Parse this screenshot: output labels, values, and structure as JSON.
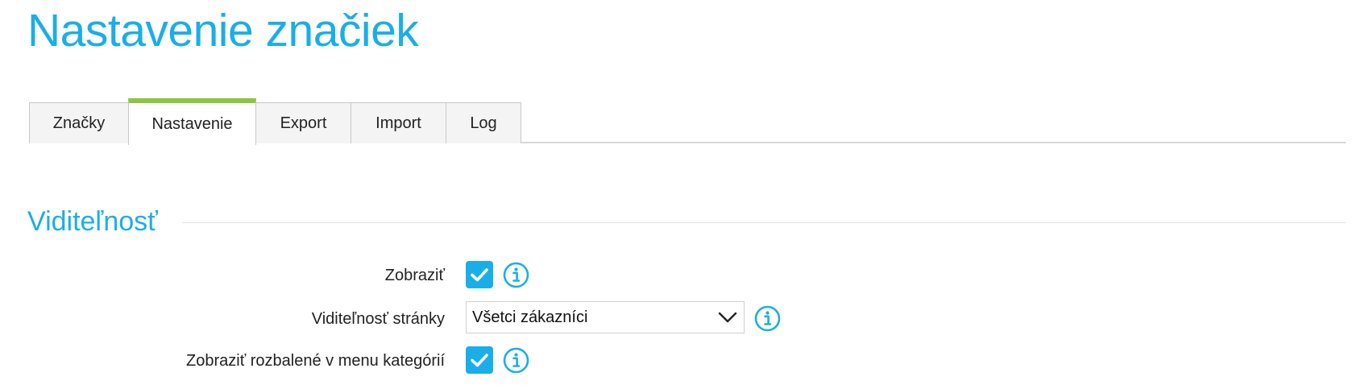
{
  "page": {
    "title": "Nastavenie značiek"
  },
  "tabs": [
    {
      "label": "Značky",
      "active": false
    },
    {
      "label": "Nastavenie",
      "active": true
    },
    {
      "label": "Export",
      "active": false
    },
    {
      "label": "Import",
      "active": false
    },
    {
      "label": "Log",
      "active": false
    }
  ],
  "section": {
    "heading": "Viditeľnosť"
  },
  "fields": {
    "show": {
      "label": "Zobraziť",
      "checked": true
    },
    "page_visibility": {
      "label": "Viditeľnosť stránky",
      "selected": "Všetci zákazníci"
    },
    "show_expanded": {
      "label": "Zobraziť rozbalené v menu kategórií",
      "checked": true
    }
  },
  "colors": {
    "accent": "#1aaee8",
    "active_tab_indicator": "#8cc63f"
  },
  "icons": {
    "checkbox": "check-icon",
    "info": "info-icon",
    "select": "chevron-down-icon"
  }
}
